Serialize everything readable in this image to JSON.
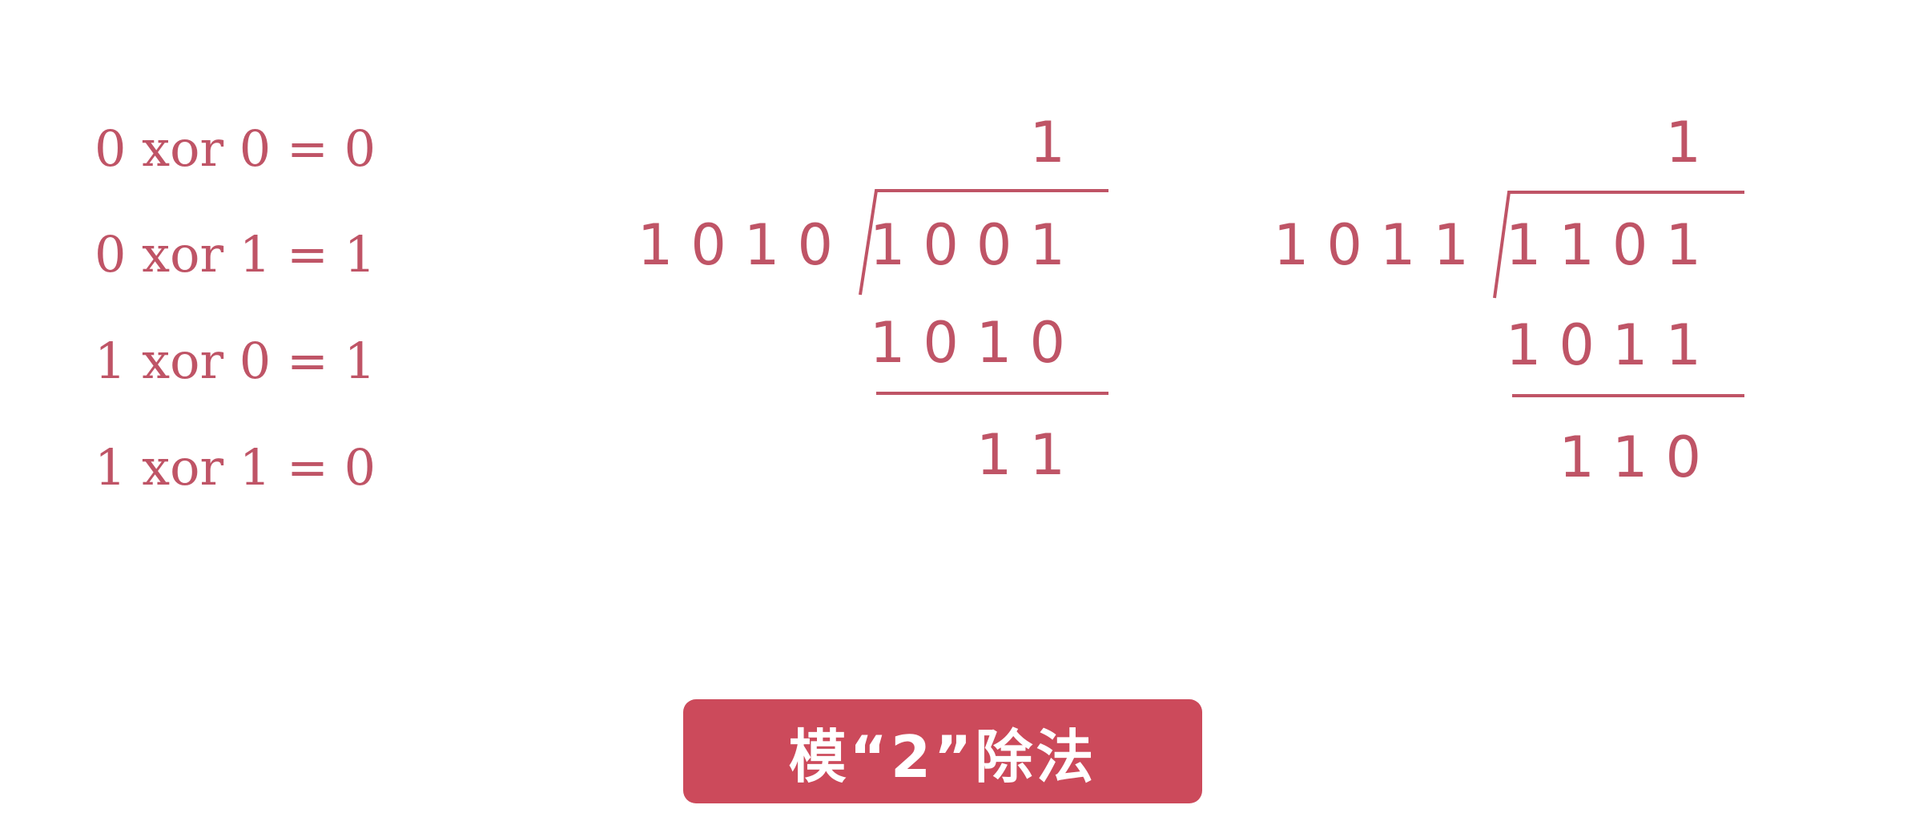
{
  "xor_table": [
    "0 xor 0 = 0",
    "0 xor 1 = 1",
    "1 xor 0 = 1",
    "1 xor 1 = 0"
  ],
  "divisions": [
    {
      "quotient": "1",
      "divisor": "1010",
      "dividend": "1001",
      "subtrahend": "1010",
      "remainder": "11"
    },
    {
      "quotient": "1",
      "divisor": "1011",
      "dividend": "1101",
      "subtrahend": "1011",
      "remainder": "110"
    }
  ],
  "title": "模“2”除法",
  "colors": {
    "text": "#bf5466",
    "button": "#cc4a5b"
  }
}
